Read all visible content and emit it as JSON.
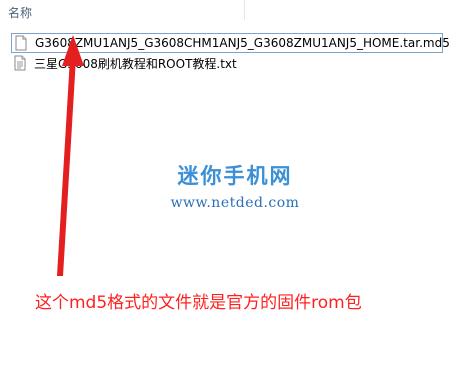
{
  "header": {
    "name_column": "名称"
  },
  "files": [
    {
      "name": "G3608ZMU1ANJ5_G3608CHM1ANJ5_G3608ZMU1ANJ5_HOME.tar.md5",
      "icon": "document-icon",
      "selected": true
    },
    {
      "name": "三星G3608刷机教程和ROOT教程.txt",
      "icon": "text-file-icon",
      "selected": false
    }
  ],
  "watermark": {
    "title": "迷你手机网",
    "url": "www.netded.com"
  },
  "annotation": {
    "text": "这个md5格式的文件就是官方的固件rom包",
    "color": "#ff2020"
  }
}
